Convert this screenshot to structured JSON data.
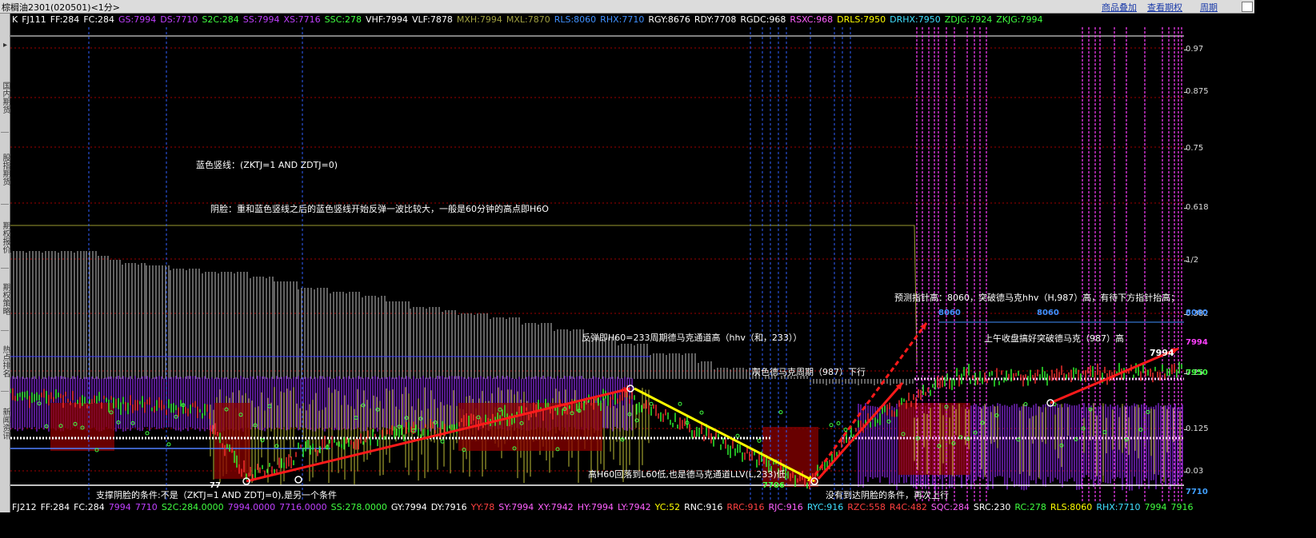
{
  "window": {
    "title": "棕榈油2301(020501)<1分>",
    "menu": [
      "商品叠加",
      "查看期权",
      "周期"
    ]
  },
  "left_tabs": [
    "国内期货",
    "股指期货",
    "期权报价",
    "期权策略",
    "热点排名",
    "新闻资讯"
  ],
  "legend_top": [
    {
      "text": "K",
      "color": "#ffffff"
    },
    {
      "text": "FJ111",
      "color": "#ffffff"
    },
    {
      "text": "FF:284",
      "color": "#ffffff"
    },
    {
      "text": "FC:284",
      "color": "#ffffff"
    },
    {
      "text": "GS:7994",
      "color": "#c040ff"
    },
    {
      "text": "DS:7710",
      "color": "#c040ff"
    },
    {
      "text": "S2C:284",
      "color": "#40ff40"
    },
    {
      "text": "SS:7994",
      "color": "#c040ff"
    },
    {
      "text": "XS:7716",
      "color": "#c040ff"
    },
    {
      "text": "SSC:278",
      "color": "#40ff40"
    },
    {
      "text": "VHF:7994",
      "color": "#ffffff"
    },
    {
      "text": "VLF:7878",
      "color": "#ffffff"
    },
    {
      "text": "MXH:7994",
      "color": "#a0a040"
    },
    {
      "text": "MXL:7870",
      "color": "#a0a040"
    },
    {
      "text": "RLS:8060",
      "color": "#4090ff"
    },
    {
      "text": "RHX:7710",
      "color": "#4090ff"
    },
    {
      "text": "RGY:8676",
      "color": "#ffffff"
    },
    {
      "text": "RDY:7708",
      "color": "#ffffff"
    },
    {
      "text": "RGDC:968",
      "color": "#ffffff"
    },
    {
      "text": "RSXC:968",
      "color": "#ff60ff"
    },
    {
      "text": "DRLS:7950",
      "color": "#ffff00"
    },
    {
      "text": "DRHX:7950",
      "color": "#40e0ff"
    },
    {
      "text": "ZDJG:7924",
      "color": "#40ff40"
    },
    {
      "text": "ZKJG:7994",
      "color": "#40ff40"
    }
  ],
  "legend_bottom": [
    {
      "text": "FJ212",
      "color": "#ffffff"
    },
    {
      "text": "FF:284",
      "color": "#ffffff"
    },
    {
      "text": "FC:284",
      "color": "#ffffff"
    },
    {
      "text": "7994",
      "color": "#c040ff"
    },
    {
      "text": "7710",
      "color": "#c040ff"
    },
    {
      "text": "S2C:284.0000",
      "color": "#40ff40"
    },
    {
      "text": "7994.0000",
      "color": "#c040ff"
    },
    {
      "text": "7716.0000",
      "color": "#c040ff"
    },
    {
      "text": "SS:278.0000",
      "color": "#40ff40"
    },
    {
      "text": "GY:7994",
      "color": "#ffffff"
    },
    {
      "text": "DY:7916",
      "color": "#ffffff"
    },
    {
      "text": "YY:78",
      "color": "#ff4040"
    },
    {
      "text": "SY:7994",
      "color": "#ff60ff"
    },
    {
      "text": "XY:7942",
      "color": "#ff60ff"
    },
    {
      "text": "HY:7994",
      "color": "#ff60ff"
    },
    {
      "text": "LY:7942",
      "color": "#ff60ff"
    },
    {
      "text": "YC:52",
      "color": "#ffff00"
    },
    {
      "text": "RNC:916",
      "color": "#ffffff"
    },
    {
      "text": "RRC:916",
      "color": "#ff4040"
    },
    {
      "text": "RJC:916",
      "color": "#ff60ff"
    },
    {
      "text": "RYC:916",
      "color": "#40e0ff"
    },
    {
      "text": "RZC:558",
      "color": "#ff4040"
    },
    {
      "text": "R4C:482",
      "color": "#ff4040"
    },
    {
      "text": "SQC:284",
      "color": "#ff60ff"
    },
    {
      "text": "SRC:230",
      "color": "#ffffff"
    },
    {
      "text": "RC:278",
      "color": "#40ff40"
    },
    {
      "text": "RLS:8060",
      "color": "#ffff00"
    },
    {
      "text": "RHX:7710",
      "color": "#40e0ff"
    },
    {
      "text": "7994",
      "color": "#40ff40"
    },
    {
      "text": "7916",
      "color": "#40ff40"
    }
  ],
  "y_axis_ticks": [
    "0.97",
    "0.875",
    "0.75",
    "0.618",
    "1/2",
    "0.382",
    "0.25",
    "0.125",
    "0.03"
  ],
  "price_labels": {
    "high": "7994",
    "rls_left": "8060",
    "rls_right": "8060",
    "rls_axis": "8060",
    "rhx_axis": "7710",
    "axis_7994": "7994",
    "axis_7950": "7950",
    "low_left": "77",
    "low_mid": "7706"
  },
  "annotations": {
    "blue_line": "蓝色竖线：(ZKTJ=1 AND ZDTJ=0)",
    "yin_face": "阴脸：重和蓝色竖线之后的蓝色竖线开始反弹一波比较大，一般是60分钟的高点即H6O",
    "rebound": "反弹即H60=233周期德马克通道高（hhv（和，233））",
    "gray_cycle": "灰色德马克周期（987）下行",
    "predict": "预测指针高：8060，突破德马克hhv（H,987）高，有待下方指针抬高；",
    "morning": "上午收盘搞好突破德马克（987）高",
    "support": "支撑阴脸的条件:不是（ZKTJ=1 AND ZDTJ=0),是另一个条件",
    "high_fall": "高H60回落到L60低,也是德马克通道LLV(L,233)低",
    "no_reach": "没有到达阴脸的条件，再次上行"
  },
  "colors": {
    "background": "#000000",
    "bull_bar": "#ff3030",
    "bear_bar": "#30ff30",
    "purple_band": "#8a2be2",
    "yellow_band": "#e0e040",
    "gray_band": "#bfbfbf",
    "magenta_vline": "#ff40ff",
    "blue_vline": "#3060ff",
    "trend_red": "#ff1a1a",
    "trend_yellow": "#ffff00"
  }
}
